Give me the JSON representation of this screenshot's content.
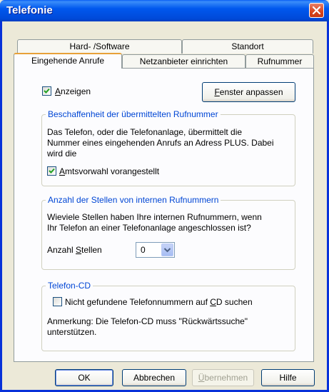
{
  "window": {
    "title": "Telefonie"
  },
  "tabs": {
    "row1": [
      "Hard- /Software",
      "Standort"
    ],
    "row2": [
      "Eingehende Anrufe",
      "Netzanbieter einrichten",
      "Rufnummer"
    ]
  },
  "show": {
    "checked": true,
    "label_underline": "A",
    "label_rest": "nzeigen"
  },
  "fit_button": {
    "underline": "F",
    "rest": "enster anpassen"
  },
  "group1": {
    "legend": "Beschaffenheit der übermittelten Rufnummer",
    "lines": [
      "Das Telefon, oder die Telefonanlage, übermittelt die",
      "Nummer eines eingehenden Anrufs an Adress PLUS. Dabei",
      "wird die"
    ],
    "checkbox": {
      "checked": true,
      "underline": "A",
      "rest": "mtsvorwahl vorangestellt"
    }
  },
  "group2": {
    "legend": "Anzahl der Stellen von internen Rufnummern",
    "lines": [
      "Wieviele Stellen haben Ihre internen Rufnummern, wenn",
      "Ihr Telefon an einer Telefonanlage angeschlossen ist?"
    ],
    "field_label_pre": "Anzahl ",
    "field_label_underline": "S",
    "field_label_post": "tellen",
    "select_value": "0"
  },
  "group3": {
    "legend": "Telefon-CD",
    "checkbox": {
      "checked": false,
      "pre": "Nicht gefundene Telefonnummern auf ",
      "underline": "C",
      "post": "D suchen"
    },
    "lines": [
      "Anmerkung: Die Telefon-CD muss \"Rückwärtssuche\"",
      "unterstützen."
    ]
  },
  "buttons": {
    "ok": "OK",
    "cancel": "Abbrechen",
    "apply_underline": "Ü",
    "apply_rest": "bernehmen",
    "help": "Hilfe"
  },
  "colors": {
    "titlebar": "#0058ee",
    "legend": "#0046d5",
    "dialog_bg": "#ece9d8",
    "panel_bg": "#fcfcfe"
  }
}
